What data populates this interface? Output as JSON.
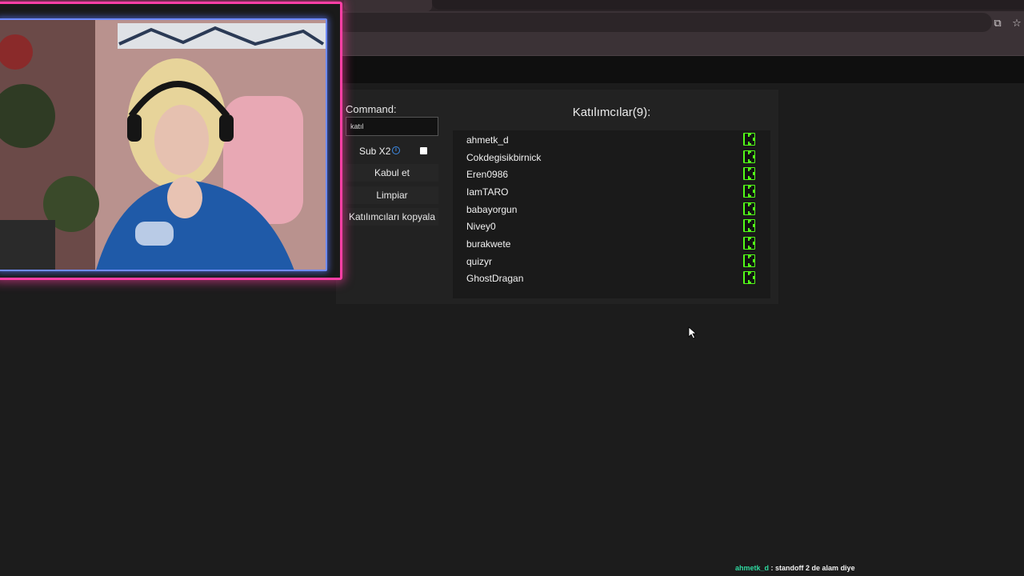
{
  "browser": {
    "translate_icon": "translate-icon",
    "bookmark_icon": "star-icon"
  },
  "controls": {
    "command_label": "Command:",
    "command_value": "katıl",
    "sub_label": "Sub X2",
    "sub_checked": false,
    "accept_label": "Kabul et",
    "clear_label": "Limpiar",
    "copy_label": "Katılımcıları kopyala"
  },
  "participants": {
    "title": "Katılımcılar(9):",
    "platform_icon": "kick-icon",
    "items": [
      "ahmetk_d",
      "Cokdegisikbirnick",
      "Eren0986",
      "IamTARO",
      "babayorgun",
      "Nivey0",
      "burakwete",
      "quizyr",
      "GhostDragan"
    ]
  },
  "chat": {
    "user": "ahmetk_d",
    "message": ": standoff 2 de alam diye"
  },
  "colors": {
    "kick_green": "#53fc18",
    "cam_border_pink": "#ff3fa5",
    "cam_border_blue": "#6f8bff",
    "chat_user": "#2fd9a0"
  }
}
